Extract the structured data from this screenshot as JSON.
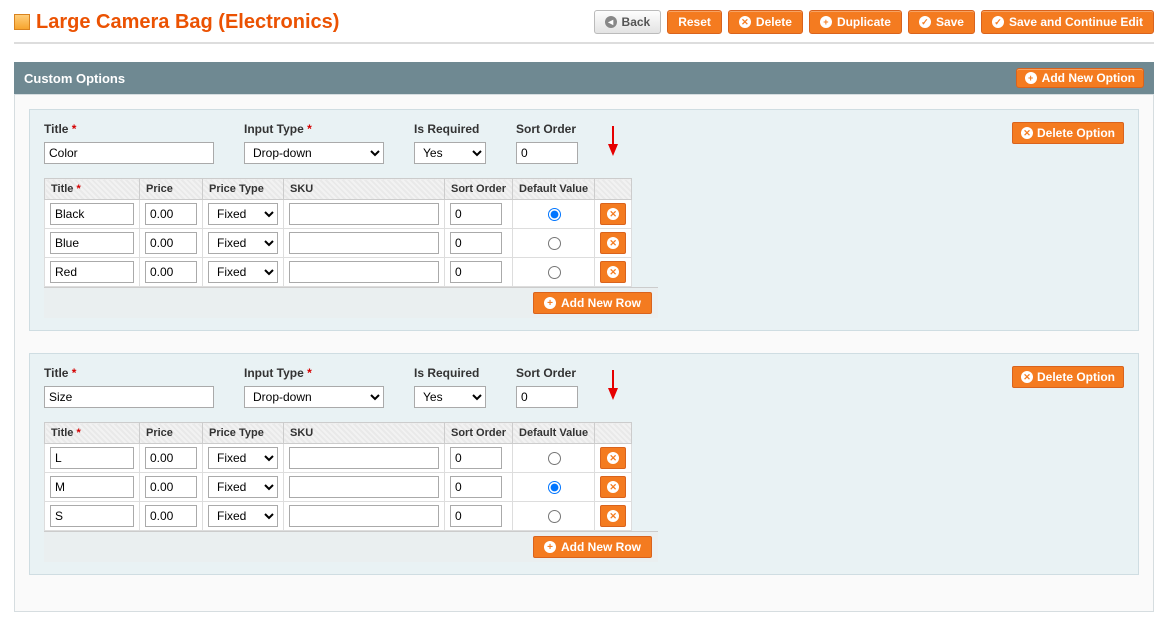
{
  "page": {
    "title": "Large Camera Bag (Electronics)"
  },
  "toolbar": {
    "back": "Back",
    "reset": "Reset",
    "delete": "Delete",
    "duplicate": "Duplicate",
    "save": "Save",
    "save_continue": "Save and Continue Edit"
  },
  "section": {
    "title": "Custom Options",
    "add_option": "Add New Option"
  },
  "labels": {
    "title": "Title",
    "input_type": "Input Type",
    "is_required": "Is Required",
    "sort_order": "Sort Order",
    "price": "Price",
    "price_type": "Price Type",
    "sku": "SKU",
    "default_value": "Default Value",
    "delete_option": "Delete Option",
    "add_new_row": "Add New Row",
    "asterisk": "*"
  },
  "selects": {
    "input_type_value": "Drop-down",
    "is_required_value": "Yes",
    "price_type_value": "Fixed"
  },
  "options": [
    {
      "title": "Color",
      "sort_order": "0",
      "rows": [
        {
          "title": "Black",
          "price": "0.00",
          "sku": "",
          "sort": "0",
          "default": true
        },
        {
          "title": "Blue",
          "price": "0.00",
          "sku": "",
          "sort": "0",
          "default": false
        },
        {
          "title": "Red",
          "price": "0.00",
          "sku": "",
          "sort": "0",
          "default": false
        }
      ]
    },
    {
      "title": "Size",
      "sort_order": "0",
      "rows": [
        {
          "title": "L",
          "price": "0.00",
          "sku": "",
          "sort": "0",
          "default": false
        },
        {
          "title": "M",
          "price": "0.00",
          "sku": "",
          "sort": "0",
          "default": true
        },
        {
          "title": "S",
          "price": "0.00",
          "sku": "",
          "sort": "0",
          "default": false
        }
      ]
    }
  ]
}
